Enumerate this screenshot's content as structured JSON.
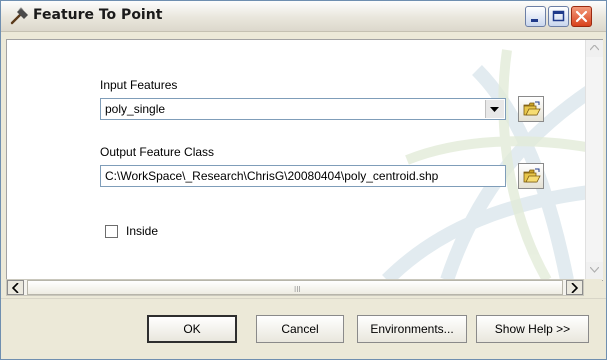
{
  "window": {
    "title": "Feature To Point",
    "icon": "hammer-icon",
    "controls": [
      "minimize-icon",
      "maximize-icon",
      "close-icon"
    ]
  },
  "form": {
    "input_features": {
      "label": "Input Features",
      "value": "poly_single",
      "browse_icon": "open-folder-icon"
    },
    "output_feature_class": {
      "label": "Output Feature Class",
      "value": "C:\\WorkSpace\\_Research\\ChrisG\\20080404\\poly_centroid.shp",
      "browse_icon": "open-folder-icon"
    },
    "inside": {
      "label": "Inside",
      "checked": false
    }
  },
  "scrollbars": {
    "horizontal_grip": "III"
  },
  "buttons": {
    "ok": "OK",
    "cancel": "Cancel",
    "environments": "Environments...",
    "show_help": "Show Help >>"
  }
}
